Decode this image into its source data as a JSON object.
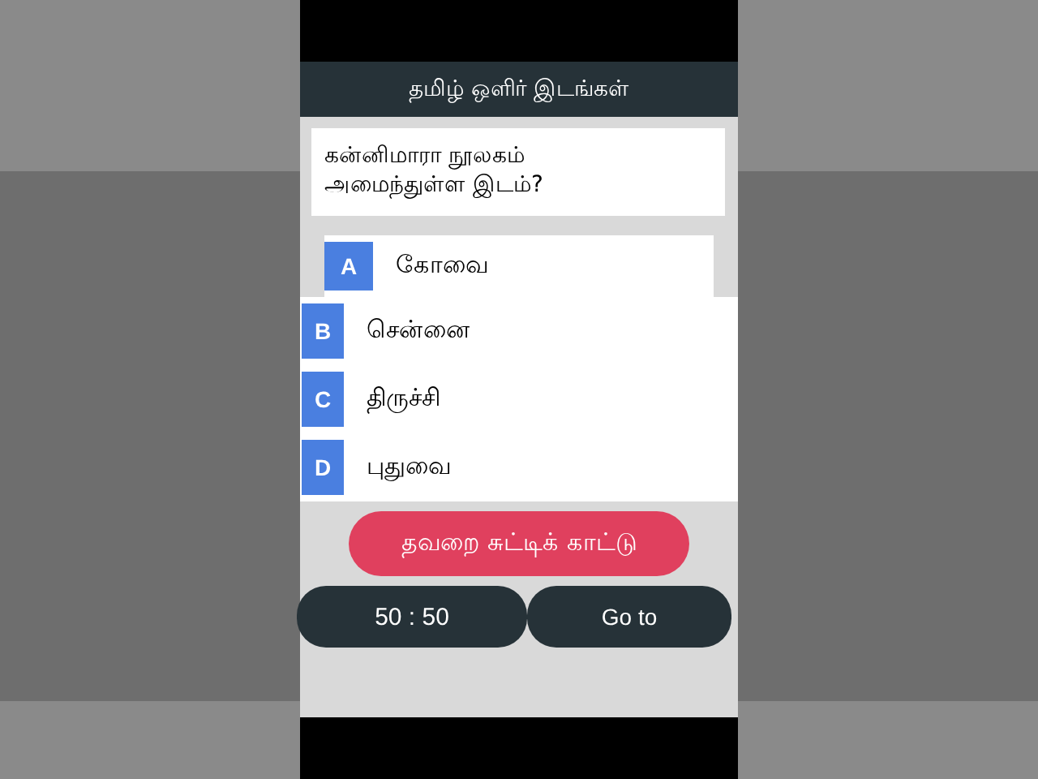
{
  "title": "தமிழ் ஒளிர் இடங்கள்",
  "question": "கன்னிமாரா நூலகம் அமைந்துள்ள இடம்?",
  "options": [
    {
      "letter": "A",
      "text": "கோவை",
      "expanded": false
    },
    {
      "letter": "B",
      "text": "சென்னை",
      "expanded": true
    },
    {
      "letter": "C",
      "text": "திருச்சி",
      "expanded": true
    },
    {
      "letter": "D",
      "text": "புதுவை",
      "expanded": true
    }
  ],
  "report_button": "தவறை சுட்டிக் காட்டு",
  "buttons": [
    "50 : 50",
    "Go to"
  ]
}
